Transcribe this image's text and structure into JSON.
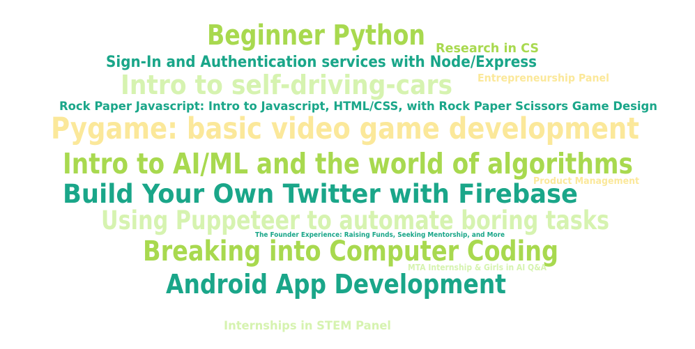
{
  "word_cloud": {
    "words": [
      {
        "text": "Beginner Python",
        "color": "#a8d94f"
      },
      {
        "text": "Research in CS",
        "color": "#a8d94f"
      },
      {
        "text": "Sign-In and Authentication services with Node/Express",
        "color": "#1aa689"
      },
      {
        "text": "Intro to self-driving-cars",
        "color": "#d6f3b0"
      },
      {
        "text": "Entrepreneurship Panel",
        "color": "#fbe89a"
      },
      {
        "text": "Rock Paper Javascript: Intro to Javascript, HTML/CSS, with Rock Paper Scissors Game Design",
        "color": "#1aa689"
      },
      {
        "text": "Pygame: basic video game development",
        "color": "#fbe89a"
      },
      {
        "text": "Intro to AI/ML and the world of algorithms",
        "color": "#a8d94f"
      },
      {
        "text": "Product Management",
        "color": "#fbe89a"
      },
      {
        "text": "Build Your Own Twitter with Firebase",
        "color": "#1aa689"
      },
      {
        "text": "Using Puppeteer to automate boring tasks",
        "color": "#d6f3b0"
      },
      {
        "text": "The Founder Experience: Raising Funds, Seeking Mentorship, and More",
        "color": "#1aa689"
      },
      {
        "text": "Breaking into Computer Coding",
        "color": "#a8d94f"
      },
      {
        "text": "MTA Internship & Girls in AI Q&A",
        "color": "#d6f3b0"
      },
      {
        "text": "Android App Development",
        "color": "#1aa689"
      },
      {
        "text": "Internships in STEM Panel",
        "color": "#d6f3b0"
      }
    ]
  }
}
